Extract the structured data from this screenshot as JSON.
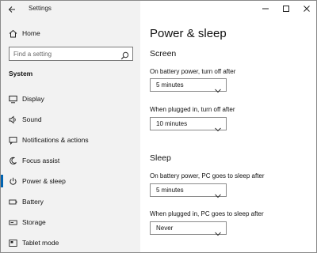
{
  "titlebar": {
    "app_title": "Settings"
  },
  "sidebar": {
    "home_label": "Home",
    "search_placeholder": "Find a setting",
    "section_label": "System",
    "items": [
      {
        "label": "Display",
        "icon": "display-icon"
      },
      {
        "label": "Sound",
        "icon": "sound-icon"
      },
      {
        "label": "Notifications & actions",
        "icon": "notifications-icon"
      },
      {
        "label": "Focus assist",
        "icon": "focus-assist-icon"
      },
      {
        "label": "Power & sleep",
        "icon": "power-icon",
        "selected": true
      },
      {
        "label": "Battery",
        "icon": "battery-icon"
      },
      {
        "label": "Storage",
        "icon": "storage-icon"
      },
      {
        "label": "Tablet mode",
        "icon": "tablet-mode-icon"
      }
    ]
  },
  "main": {
    "title": "Power & sleep",
    "screen": {
      "heading": "Screen",
      "battery_label": "On battery power, turn off after",
      "battery_value": "5 minutes",
      "plugged_label": "When plugged in, turn off after",
      "plugged_value": "10 minutes"
    },
    "sleep": {
      "heading": "Sleep",
      "battery_label": "On battery power, PC goes to sleep after",
      "battery_value": "5 minutes",
      "plugged_label": "When plugged in, PC goes to sleep after",
      "plugged_value": "Never"
    }
  },
  "colors": {
    "accent": "#0063b1",
    "sidebar_bg": "#f2f2f2",
    "content_bg": "#ffffff"
  }
}
